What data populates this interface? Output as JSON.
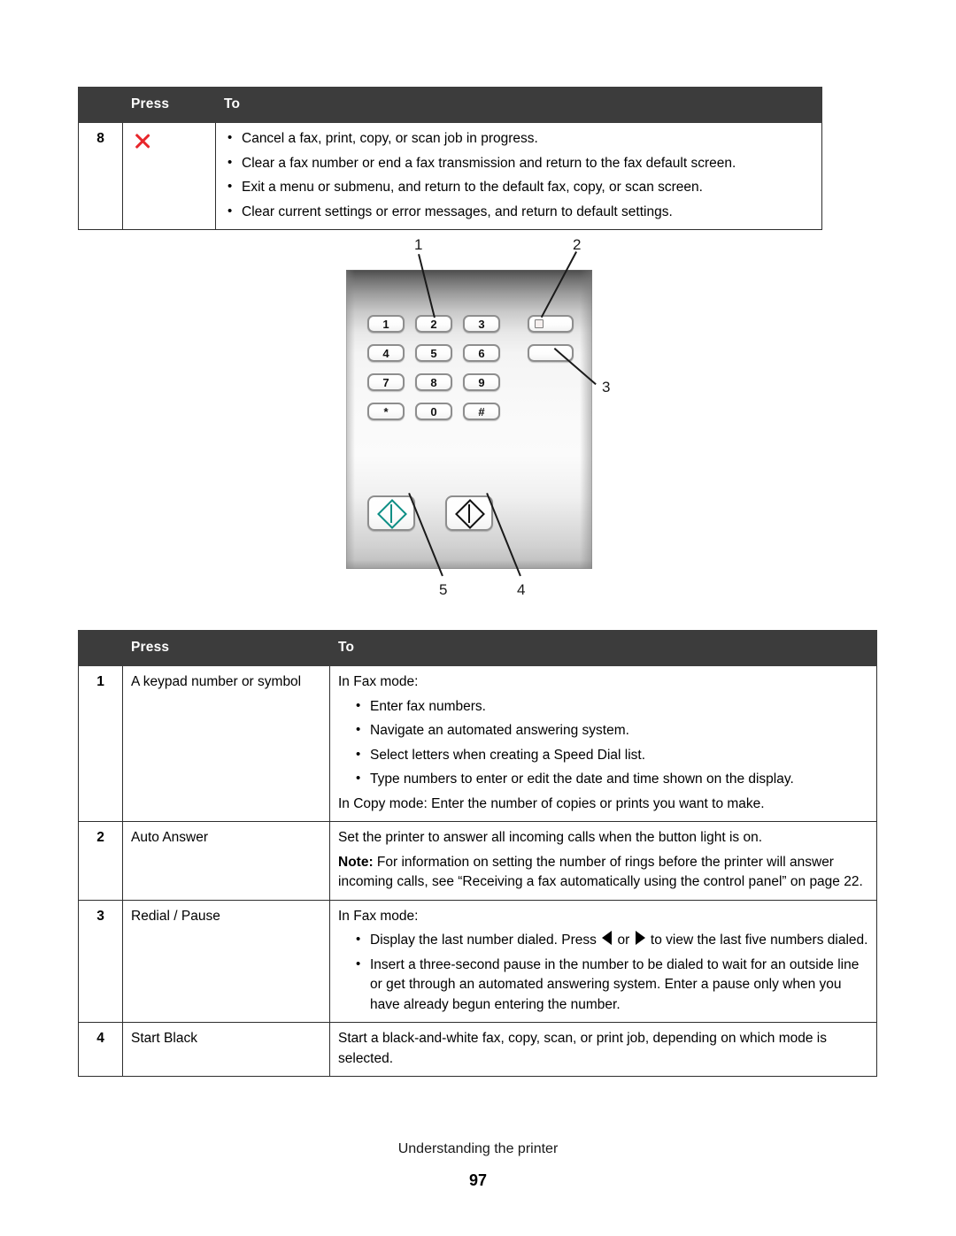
{
  "document": {
    "footer_caption": "Understanding the printer",
    "page_number": "97"
  },
  "table_top": {
    "headers": {
      "num": "",
      "press": "Press",
      "to": "To"
    },
    "rows": [
      {
        "num": "8",
        "press_icon": "cancel-x-icon",
        "press_icon_color": "#e8262b",
        "bullets": [
          "Cancel a fax, print, copy, or scan job in progress.",
          "Clear a fax number or end a fax transmission and return to the fax default screen.",
          "Exit a menu or submenu, and return to the default fax, copy, or scan screen.",
          "Clear current settings or error messages, and return to default settings."
        ]
      }
    ]
  },
  "figure": {
    "name": "printer-control-panel-keypad",
    "keypad_keys": [
      "1",
      "2",
      "3",
      "4",
      "5",
      "6",
      "7",
      "8",
      "9",
      "*",
      "0",
      "#"
    ],
    "callouts": [
      {
        "label": "1",
        "points_to": "keypad-number-or-symbol"
      },
      {
        "label": "2",
        "points_to": "auto-answer-button"
      },
      {
        "label": "3",
        "points_to": "redial-pause-button"
      },
      {
        "label": "4",
        "points_to": "start-black-button"
      },
      {
        "label": "5",
        "points_to": "start-color-button"
      }
    ],
    "start_color_accent": "#0d8e85",
    "start_black_accent": "#111111"
  },
  "table_bottom": {
    "headers": {
      "num": "",
      "press": "Press",
      "to": "To"
    },
    "rows": [
      {
        "num": "1",
        "press": "A keypad number or symbol",
        "intro": "In Fax mode:",
        "bullets": [
          "Enter fax numbers.",
          "Navigate an automated answering system.",
          "Select letters when creating a Speed Dial list.",
          "Type numbers to enter or edit the date and time shown on the display."
        ],
        "outro": "In Copy mode: Enter the number of copies or prints you want to make."
      },
      {
        "num": "2",
        "press": "Auto Answer",
        "line1": "Set the printer to answer all incoming calls when the button light is on.",
        "note_label": "Note:",
        "note_text": " For information on setting the number of rings before the printer will answer incoming calls, see “Receiving a fax automatically using the control panel” on page 22."
      },
      {
        "num": "3",
        "press": "Redial / Pause",
        "intro": "In Fax mode:",
        "bullet_1_pre": "Display the last number dialed. Press ",
        "bullet_1_mid": " or ",
        "bullet_1_post": " to view the last five numbers dialed.",
        "bullet_2": "Insert a three-second pause in the number to be dialed to wait for an outside line or get through an automated answering system. Enter a pause only when you have already begun entering the number."
      },
      {
        "num": "4",
        "press": "Start Black",
        "text": "Start a black-and-white fax, copy, scan, or print job, depending on which mode is selected."
      }
    ]
  }
}
